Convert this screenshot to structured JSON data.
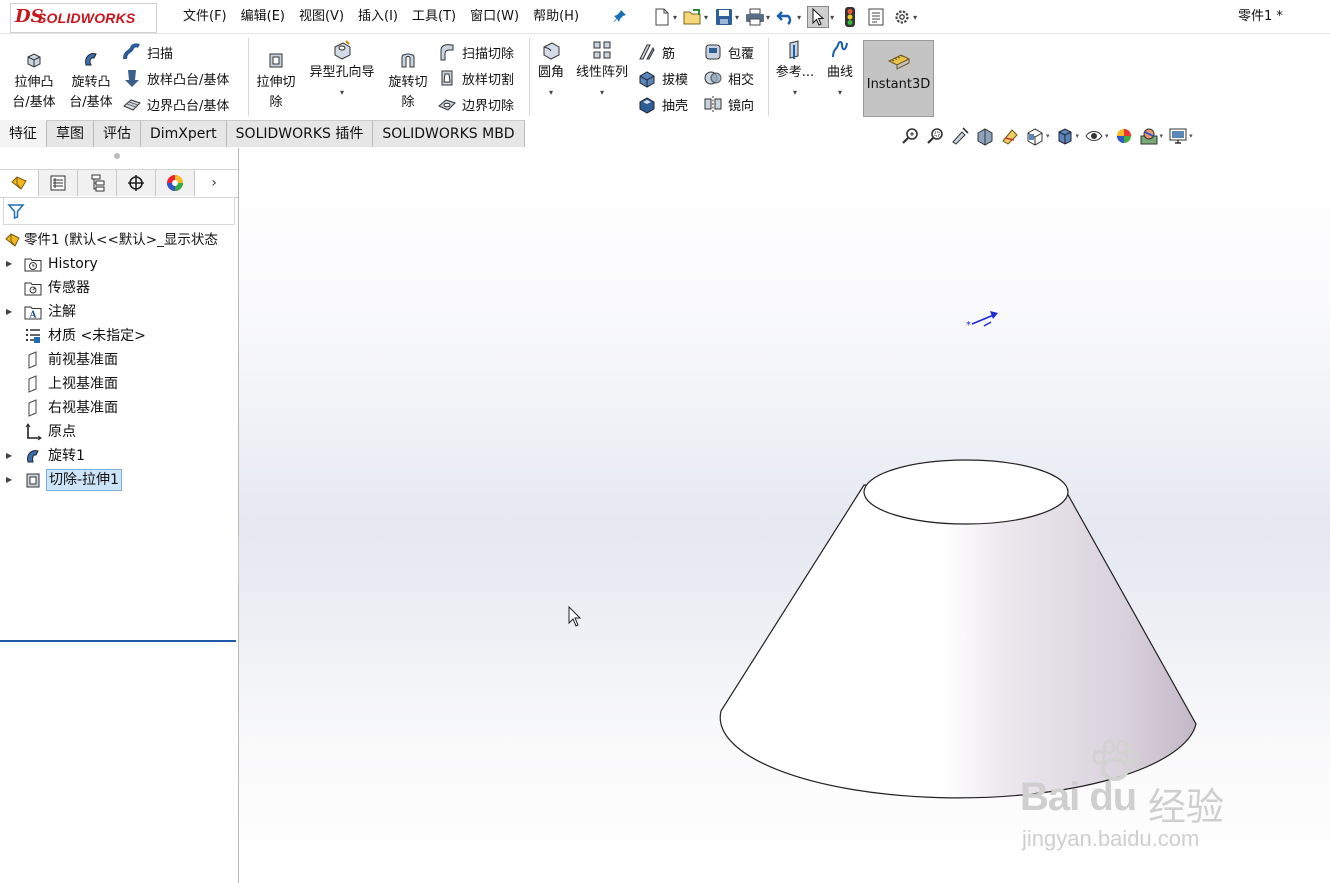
{
  "app": {
    "logo_prefix": "DS",
    "logo_text": "SOLIDWORKS"
  },
  "menu": [
    "文件(F)",
    "编辑(E)",
    "视图(V)",
    "插入(I)",
    "工具(T)",
    "窗口(W)",
    "帮助(H)"
  ],
  "document_title": "零件1 *",
  "ribbon": {
    "extrude_boss": "拉伸凸\n台/基体",
    "revolve_boss": "旋转凸\n台/基体",
    "sweep": "扫描",
    "loft_boss": "放样凸台/基体",
    "boundary_boss": "边界凸台/基体",
    "extrude_cut": "拉伸切\n除",
    "hole_wizard": "异型孔向导",
    "revolve_cut": "旋转切\n除",
    "swept_cut": "扫描切除",
    "lofted_cut": "放样切割",
    "boundary_cut": "边界切除",
    "fillet": "圆角",
    "linear_pattern": "线性阵列",
    "rib": "筋",
    "draft": "拔模",
    "shell": "抽壳",
    "wrap": "包覆",
    "intersect": "相交",
    "mirror": "镜向",
    "reference": "参考...",
    "curves": "曲线",
    "instant3d": "Instant3D"
  },
  "tabs": [
    "特征",
    "草图",
    "评估",
    "DimXpert",
    "SOLIDWORKS 插件",
    "SOLIDWORKS MBD"
  ],
  "active_tab": "特征",
  "tree": {
    "root": "零件1  (默认<<默认>_显示状态",
    "items": [
      {
        "label": "History",
        "expandable": true
      },
      {
        "label": "传感器",
        "expandable": false
      },
      {
        "label": "注解",
        "expandable": true
      },
      {
        "label": "材质 <未指定>",
        "expandable": false
      },
      {
        "label": "前视基准面",
        "expandable": false
      },
      {
        "label": "上视基准面",
        "expandable": false
      },
      {
        "label": "右视基准面",
        "expandable": false
      },
      {
        "label": "原点",
        "expandable": false
      },
      {
        "label": "旋转1",
        "expandable": true
      },
      {
        "label": "切除-拉伸1",
        "expandable": true,
        "selected": true
      }
    ]
  },
  "watermark": {
    "brand": "Bai du",
    "brand_cn": "经验",
    "url": "jingyan.baidu.com"
  },
  "colors": {
    "logo_red": "#c8161d",
    "selection_blue": "#1e5aa8",
    "triad_blue": "#1a2bd6"
  }
}
